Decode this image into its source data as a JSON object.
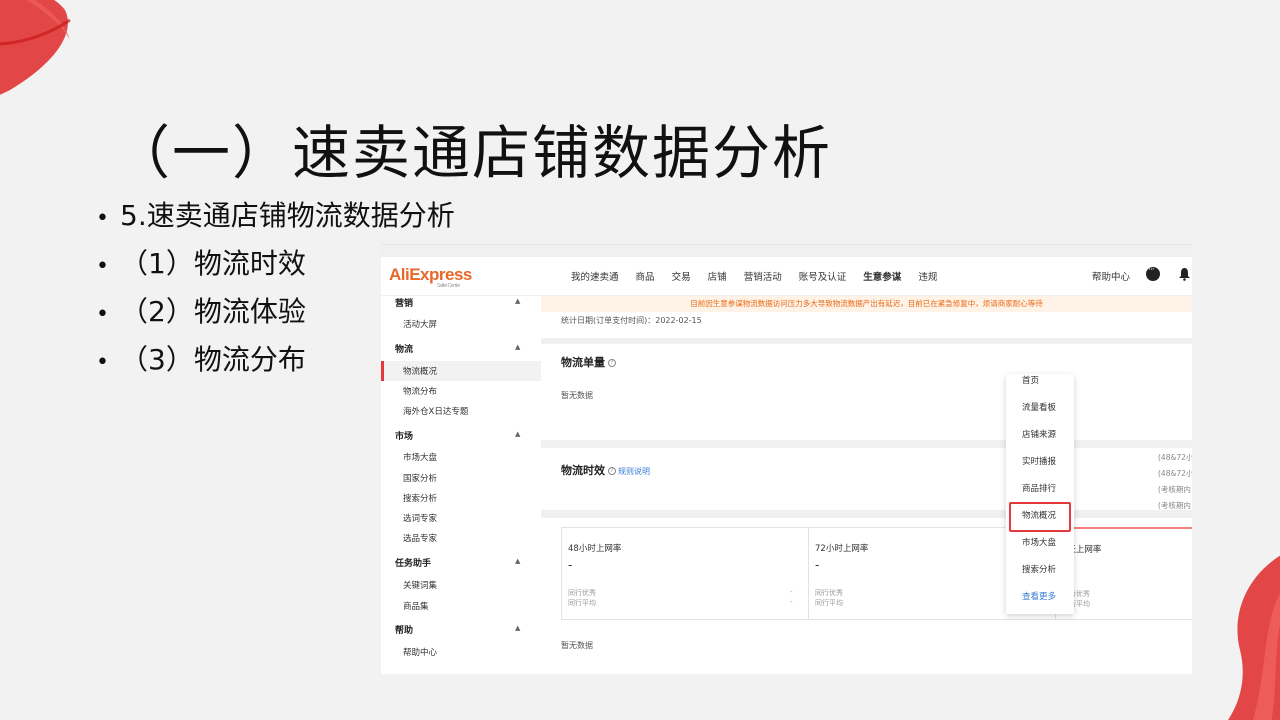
{
  "slide": {
    "title": "（一）速卖通店铺数据分析",
    "bullets": [
      "5.速卖通店铺物流数据分析",
      "（1）物流时效",
      "（2）物流体验",
      "（3）物流分布"
    ]
  },
  "screenshot": {
    "logo": "AliExpress",
    "logo_sub": "Seller Center",
    "nav": [
      "我的速卖通",
      "商品",
      "交易",
      "店铺",
      "营销活动",
      "账号及认证",
      "生意参谋",
      "违规"
    ],
    "nav_active": "生意参谋",
    "help": "帮助中心",
    "notice": "目前因生意参谋物流数据访问压力多大导致物流数据产出有延迟，目前已在紧急修复中，烦请商家耐心等待",
    "sidebar": {
      "marketing": "营销",
      "activity_screen": "活动大屏",
      "logistics": "物流",
      "logistics_overview": "物流概况",
      "logistics_distribution": "物流分布",
      "overseas_special": "海外仓X日达专题",
      "market": "市场",
      "market_overview": "市场大盘",
      "country_analysis": "国家分析",
      "search_analysis": "搜索分析",
      "keyword_expert": "选词专家",
      "product_expert": "选品专家",
      "task_helper": "任务助手",
      "keyword_set": "关键词集",
      "product_set": "商品集",
      "help": "帮助",
      "help_center": "帮助中心"
    },
    "stat_date": "统计日期(订单支付时间)：2022-02-15",
    "volume_title": "物流单量",
    "no_data": "暂无数据",
    "timeliness_title": "物流时效",
    "rule_link": "规则说明",
    "side_hints": [
      "(48&72小",
      "(48&72小",
      "(考核期内",
      "(考核期内"
    ],
    "metrics": [
      {
        "name": "48小时上网率",
        "value": "-",
        "peer_good": "同行优秀",
        "peer_avg": "同行平均",
        "good_val": "-",
        "avg_val": "-"
      },
      {
        "name": "72小时上网率",
        "value": "-",
        "peer_good": "同行优秀",
        "peer_avg": "同行平均",
        "good_val": "-",
        "avg_val": "-"
      },
      {
        "name": "5天上网率",
        "value": "-",
        "peer_good": "同行优秀",
        "peer_avg": "同行平均",
        "good_val": "",
        "avg_val": ""
      }
    ],
    "dropdown": [
      "首页",
      "流量看板",
      "店铺来源",
      "实时播报",
      "商品排行",
      "物流概况",
      "市场大盘",
      "搜索分析",
      "查看更多"
    ],
    "dropdown_highlight": "物流概况",
    "accent": "#e4393c"
  }
}
